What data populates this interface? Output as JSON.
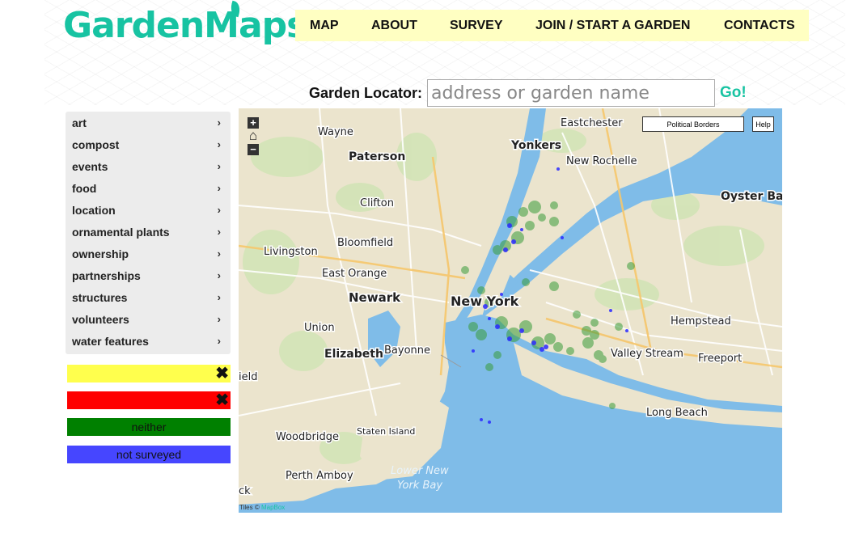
{
  "app": {
    "logo_text": "GardenMaps"
  },
  "nav": {
    "items": [
      "MAP",
      "ABOUT",
      "SURVEY",
      "JOIN / START A GARDEN",
      "CONTACTS"
    ]
  },
  "locator": {
    "label": "Garden Locator:",
    "placeholder": "address or garden name",
    "value": "",
    "go_label": "Go!"
  },
  "sidebar": {
    "items": [
      "art",
      "compost",
      "events",
      "food",
      "location",
      "ornamental plants",
      "ownership",
      "partnerships",
      "structures",
      "volunteers",
      "water features"
    ]
  },
  "legend": {
    "items": [
      {
        "label": "",
        "color": "#ffff4d",
        "has_close": true
      },
      {
        "label": "",
        "color": "#ff0000",
        "has_close": true
      },
      {
        "label": "neither",
        "color": "#008000",
        "has_close": false
      },
      {
        "label": "not surveyed",
        "color": "#4646ff",
        "has_close": false
      }
    ]
  },
  "map": {
    "buttons": {
      "political_borders": "Political Borders",
      "help": "Help"
    },
    "zoom": {
      "in": "+",
      "home": "⌂",
      "out": "−"
    },
    "attribution": {
      "prefix": "Tiles ©",
      "link": "MapBox"
    },
    "places": {
      "wayne": "Wayne",
      "paterson": "Paterson",
      "clifton": "Clifton",
      "livingston": "Livingston",
      "bloomfield": "Bloomfield",
      "east_orange": "East Orange",
      "newark": "Newark",
      "union": "Union",
      "elizabeth": "Elizabeth",
      "bayonne": "Bayonne",
      "woodbridge": "Woodbridge",
      "staten_island": "Staten Island",
      "perth_amboy": "Perth Amboy",
      "eastchester": "Eastchester",
      "yonkers": "Yonkers",
      "new_rochelle": "New Rochelle",
      "oyster_bay": "Oyster Bay",
      "new_york": "New York",
      "hempstead": "Hempstead",
      "valley_stream": "Valley Stream",
      "freeport": "Freeport",
      "long_beach": "Long Beach",
      "lower_ny_bay_1": "Lower New",
      "lower_ny_bay_2": "York Bay",
      "edge_ck": "ck",
      "edge_field": "ield"
    }
  }
}
